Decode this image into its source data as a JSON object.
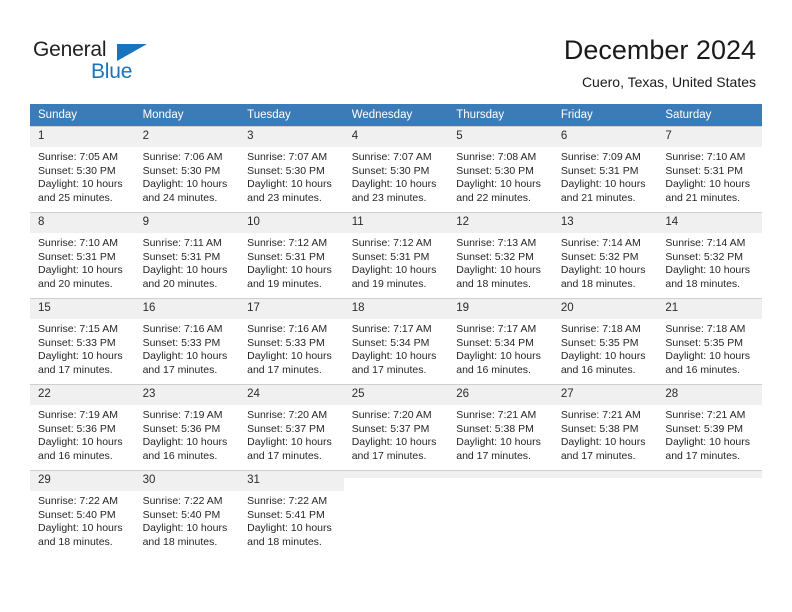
{
  "logo": {
    "word_top": "General",
    "word_bottom": "Blue",
    "triangle_color": "#1a74bb",
    "text_color": "#231f20"
  },
  "header": {
    "title": "December 2024",
    "subtitle": "Cuero, Texas, United States",
    "header_bg": "#3b7cb8",
    "daynum_bg": "#f0f0f0"
  },
  "weekdays": [
    "Sunday",
    "Monday",
    "Tuesday",
    "Wednesday",
    "Thursday",
    "Friday",
    "Saturday"
  ],
  "weeks": [
    [
      {
        "day": "1",
        "sunrise": "Sunrise: 7:05 AM",
        "sunset": "Sunset: 5:30 PM",
        "daylight1": "Daylight: 10 hours",
        "daylight2": "and 25 minutes."
      },
      {
        "day": "2",
        "sunrise": "Sunrise: 7:06 AM",
        "sunset": "Sunset: 5:30 PM",
        "daylight1": "Daylight: 10 hours",
        "daylight2": "and 24 minutes."
      },
      {
        "day": "3",
        "sunrise": "Sunrise: 7:07 AM",
        "sunset": "Sunset: 5:30 PM",
        "daylight1": "Daylight: 10 hours",
        "daylight2": "and 23 minutes."
      },
      {
        "day": "4",
        "sunrise": "Sunrise: 7:07 AM",
        "sunset": "Sunset: 5:30 PM",
        "daylight1": "Daylight: 10 hours",
        "daylight2": "and 23 minutes."
      },
      {
        "day": "5",
        "sunrise": "Sunrise: 7:08 AM",
        "sunset": "Sunset: 5:30 PM",
        "daylight1": "Daylight: 10 hours",
        "daylight2": "and 22 minutes."
      },
      {
        "day": "6",
        "sunrise": "Sunrise: 7:09 AM",
        "sunset": "Sunset: 5:31 PM",
        "daylight1": "Daylight: 10 hours",
        "daylight2": "and 21 minutes."
      },
      {
        "day": "7",
        "sunrise": "Sunrise: 7:10 AM",
        "sunset": "Sunset: 5:31 PM",
        "daylight1": "Daylight: 10 hours",
        "daylight2": "and 21 minutes."
      }
    ],
    [
      {
        "day": "8",
        "sunrise": "Sunrise: 7:10 AM",
        "sunset": "Sunset: 5:31 PM",
        "daylight1": "Daylight: 10 hours",
        "daylight2": "and 20 minutes."
      },
      {
        "day": "9",
        "sunrise": "Sunrise: 7:11 AM",
        "sunset": "Sunset: 5:31 PM",
        "daylight1": "Daylight: 10 hours",
        "daylight2": "and 20 minutes."
      },
      {
        "day": "10",
        "sunrise": "Sunrise: 7:12 AM",
        "sunset": "Sunset: 5:31 PM",
        "daylight1": "Daylight: 10 hours",
        "daylight2": "and 19 minutes."
      },
      {
        "day": "11",
        "sunrise": "Sunrise: 7:12 AM",
        "sunset": "Sunset: 5:31 PM",
        "daylight1": "Daylight: 10 hours",
        "daylight2": "and 19 minutes."
      },
      {
        "day": "12",
        "sunrise": "Sunrise: 7:13 AM",
        "sunset": "Sunset: 5:32 PM",
        "daylight1": "Daylight: 10 hours",
        "daylight2": "and 18 minutes."
      },
      {
        "day": "13",
        "sunrise": "Sunrise: 7:14 AM",
        "sunset": "Sunset: 5:32 PM",
        "daylight1": "Daylight: 10 hours",
        "daylight2": "and 18 minutes."
      },
      {
        "day": "14",
        "sunrise": "Sunrise: 7:14 AM",
        "sunset": "Sunset: 5:32 PM",
        "daylight1": "Daylight: 10 hours",
        "daylight2": "and 18 minutes."
      }
    ],
    [
      {
        "day": "15",
        "sunrise": "Sunrise: 7:15 AM",
        "sunset": "Sunset: 5:33 PM",
        "daylight1": "Daylight: 10 hours",
        "daylight2": "and 17 minutes."
      },
      {
        "day": "16",
        "sunrise": "Sunrise: 7:16 AM",
        "sunset": "Sunset: 5:33 PM",
        "daylight1": "Daylight: 10 hours",
        "daylight2": "and 17 minutes."
      },
      {
        "day": "17",
        "sunrise": "Sunrise: 7:16 AM",
        "sunset": "Sunset: 5:33 PM",
        "daylight1": "Daylight: 10 hours",
        "daylight2": "and 17 minutes."
      },
      {
        "day": "18",
        "sunrise": "Sunrise: 7:17 AM",
        "sunset": "Sunset: 5:34 PM",
        "daylight1": "Daylight: 10 hours",
        "daylight2": "and 17 minutes."
      },
      {
        "day": "19",
        "sunrise": "Sunrise: 7:17 AM",
        "sunset": "Sunset: 5:34 PM",
        "daylight1": "Daylight: 10 hours",
        "daylight2": "and 16 minutes."
      },
      {
        "day": "20",
        "sunrise": "Sunrise: 7:18 AM",
        "sunset": "Sunset: 5:35 PM",
        "daylight1": "Daylight: 10 hours",
        "daylight2": "and 16 minutes."
      },
      {
        "day": "21",
        "sunrise": "Sunrise: 7:18 AM",
        "sunset": "Sunset: 5:35 PM",
        "daylight1": "Daylight: 10 hours",
        "daylight2": "and 16 minutes."
      }
    ],
    [
      {
        "day": "22",
        "sunrise": "Sunrise: 7:19 AM",
        "sunset": "Sunset: 5:36 PM",
        "daylight1": "Daylight: 10 hours",
        "daylight2": "and 16 minutes."
      },
      {
        "day": "23",
        "sunrise": "Sunrise: 7:19 AM",
        "sunset": "Sunset: 5:36 PM",
        "daylight1": "Daylight: 10 hours",
        "daylight2": "and 16 minutes."
      },
      {
        "day": "24",
        "sunrise": "Sunrise: 7:20 AM",
        "sunset": "Sunset: 5:37 PM",
        "daylight1": "Daylight: 10 hours",
        "daylight2": "and 17 minutes."
      },
      {
        "day": "25",
        "sunrise": "Sunrise: 7:20 AM",
        "sunset": "Sunset: 5:37 PM",
        "daylight1": "Daylight: 10 hours",
        "daylight2": "and 17 minutes."
      },
      {
        "day": "26",
        "sunrise": "Sunrise: 7:21 AM",
        "sunset": "Sunset: 5:38 PM",
        "daylight1": "Daylight: 10 hours",
        "daylight2": "and 17 minutes."
      },
      {
        "day": "27",
        "sunrise": "Sunrise: 7:21 AM",
        "sunset": "Sunset: 5:38 PM",
        "daylight1": "Daylight: 10 hours",
        "daylight2": "and 17 minutes."
      },
      {
        "day": "28",
        "sunrise": "Sunrise: 7:21 AM",
        "sunset": "Sunset: 5:39 PM",
        "daylight1": "Daylight: 10 hours",
        "daylight2": "and 17 minutes."
      }
    ],
    [
      {
        "day": "29",
        "sunrise": "Sunrise: 7:22 AM",
        "sunset": "Sunset: 5:40 PM",
        "daylight1": "Daylight: 10 hours",
        "daylight2": "and 18 minutes."
      },
      {
        "day": "30",
        "sunrise": "Sunrise: 7:22 AM",
        "sunset": "Sunset: 5:40 PM",
        "daylight1": "Daylight: 10 hours",
        "daylight2": "and 18 minutes."
      },
      {
        "day": "31",
        "sunrise": "Sunrise: 7:22 AM",
        "sunset": "Sunset: 5:41 PM",
        "daylight1": "Daylight: 10 hours",
        "daylight2": "and 18 minutes."
      },
      {
        "day": "",
        "sunrise": "",
        "sunset": "",
        "daylight1": "",
        "daylight2": ""
      },
      {
        "day": "",
        "sunrise": "",
        "sunset": "",
        "daylight1": "",
        "daylight2": ""
      },
      {
        "day": "",
        "sunrise": "",
        "sunset": "",
        "daylight1": "",
        "daylight2": ""
      },
      {
        "day": "",
        "sunrise": "",
        "sunset": "",
        "daylight1": "",
        "daylight2": ""
      }
    ]
  ]
}
